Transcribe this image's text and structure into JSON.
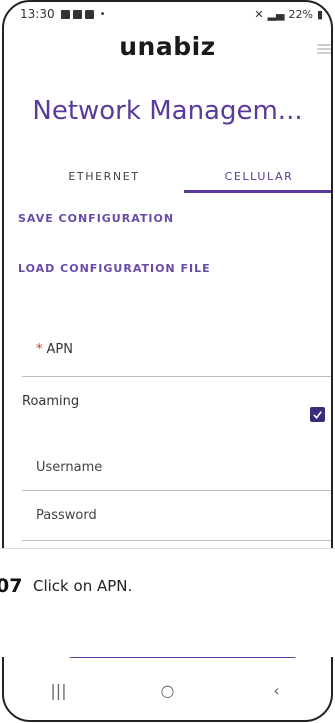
{
  "status_bar": {
    "time": "13:30",
    "dot": "•",
    "battery": "22%"
  },
  "app": {
    "logo": "unabiz",
    "page_title": "Network Managem..."
  },
  "tabs": [
    {
      "label": "ETHERNET"
    },
    {
      "label": "CELLULAR"
    }
  ],
  "actions": {
    "save": "SAVE CONFIGURATION",
    "load": "LOAD CONFIGURATION FILE"
  },
  "form": {
    "apn_star": "*",
    "apn_label": "APN",
    "roaming_label": "Roaming",
    "roaming_checked": true,
    "username_label": "Username",
    "password_label": "Password"
  },
  "caption": {
    "step": "07",
    "text": "Click on APN."
  },
  "navbar": {
    "recent": "|||",
    "home": "○",
    "back": "‹"
  },
  "colors": {
    "accent": "#5b3a9b",
    "checkbox": "#3b2d7a",
    "required": "#d03b3b"
  }
}
